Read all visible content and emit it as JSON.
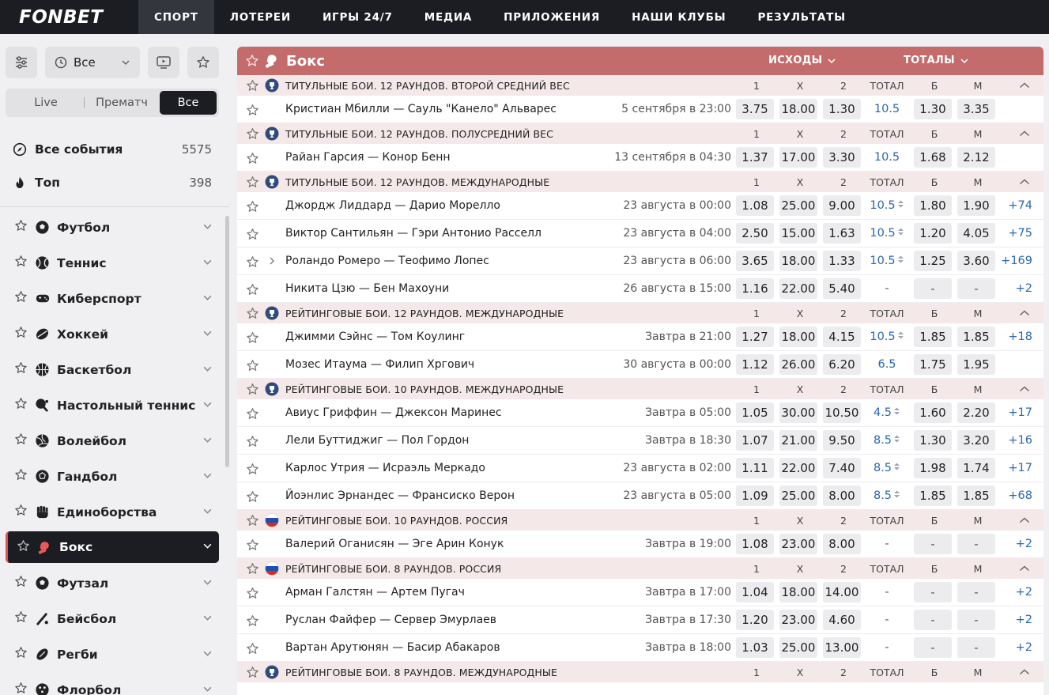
{
  "brand": "FONBET",
  "nav": [
    "СПОРТ",
    "ЛОТЕРЕИ",
    "ИГРЫ 24/7",
    "МЕДИА",
    "ПРИЛОЖЕНИЯ",
    "НАШИ КЛУБЫ",
    "РЕЗУЛЬТАТЫ"
  ],
  "sidebar": {
    "time_filter": "Все",
    "segments": [
      "Live",
      "Прематч",
      "Все"
    ],
    "summary": [
      {
        "label": "Все события",
        "count": "5575",
        "icon": "compass-icon"
      },
      {
        "label": "Топ",
        "count": "398",
        "icon": "flame-icon"
      }
    ],
    "sports": [
      {
        "label": "Футбол",
        "icon": "football-icon"
      },
      {
        "label": "Теннис",
        "icon": "tennis-icon"
      },
      {
        "label": "Киберспорт",
        "icon": "gamepad-icon"
      },
      {
        "label": "Хоккей",
        "icon": "hockey-icon"
      },
      {
        "label": "Баскетбол",
        "icon": "basketball-icon"
      },
      {
        "label": "Настольный теннис",
        "icon": "table-tennis-icon"
      },
      {
        "label": "Волейбол",
        "icon": "volleyball-icon"
      },
      {
        "label": "Гандбол",
        "icon": "handball-icon"
      },
      {
        "label": "Единоборства",
        "icon": "fist-icon"
      },
      {
        "label": "Бокс",
        "icon": "boxing-glove-icon",
        "active": true
      },
      {
        "label": "Футзал",
        "icon": "futsal-icon"
      },
      {
        "label": "Бейсбол",
        "icon": "baseball-icon"
      },
      {
        "label": "Регби",
        "icon": "rugby-icon"
      },
      {
        "label": "Флорбол",
        "icon": "floorball-icon"
      }
    ]
  },
  "main": {
    "title": "Бокс",
    "tab_outcomes": "ИСХОДЫ",
    "tab_totals": "ТОТАЛЫ",
    "columns": [
      "1",
      "X",
      "2",
      "ТОТАЛ",
      "Б",
      "М"
    ],
    "groups": [
      {
        "title": "ТИТУЛЬНЫЕ БОИ. 12 РАУНДОВ. ВТОРОЙ СРЕДНИЙ ВЕС",
        "flag": "cup",
        "events": [
          {
            "name": "Кристиан Мбилли — Сауль \"Канело\" Альварес",
            "time": "5 сентября в 23:00",
            "o1": "3.75",
            "ox": "18.00",
            "o2": "1.30",
            "total": "10.5",
            "b": "1.30",
            "m": "3.35",
            "more": "",
            "arrows": false,
            "expand": false
          }
        ]
      },
      {
        "title": "ТИТУЛЬНЫЕ БОИ. 12 РАУНДОВ. ПОЛУСРЕДНИЙ ВЕС",
        "flag": "cup",
        "events": [
          {
            "name": "Райан Гарсия — Конор Бенн",
            "time": "13 сентября в 04:30",
            "o1": "1.37",
            "ox": "17.00",
            "o2": "3.30",
            "total": "10.5",
            "b": "1.68",
            "m": "2.12",
            "more": "",
            "arrows": false,
            "expand": false
          }
        ]
      },
      {
        "title": "ТИТУЛЬНЫЕ БОИ. 12 РАУНДОВ. МЕЖДУНАРОДНЫЕ",
        "flag": "cup",
        "events": [
          {
            "name": "Джордж Лиддард — Дарио Морелло",
            "time": "23 августа в 00:00",
            "o1": "1.08",
            "ox": "25.00",
            "o2": "9.00",
            "total": "10.5",
            "b": "1.80",
            "m": "1.90",
            "more": "+74",
            "arrows": true,
            "expand": false
          },
          {
            "name": "Виктор Сантильян — Гэри Антонио Расселл",
            "time": "23 августа в 04:00",
            "o1": "2.50",
            "ox": "15.00",
            "o2": "1.63",
            "total": "10.5",
            "b": "1.20",
            "m": "4.05",
            "more": "+75",
            "arrows": true,
            "expand": false
          },
          {
            "name": "Роландо Ромеро — Теофимо Лопес",
            "time": "23 августа в 06:00",
            "o1": "3.65",
            "ox": "18.00",
            "o2": "1.33",
            "total": "10.5",
            "b": "1.25",
            "m": "3.60",
            "more": "+169",
            "arrows": true,
            "expand": true
          },
          {
            "name": "Никита Цзю — Бен Махоуни",
            "time": "26 августа в 15:00",
            "o1": "1.16",
            "ox": "22.00",
            "o2": "5.40",
            "total": "-",
            "b": "-",
            "m": "-",
            "more": "+2",
            "arrows": false,
            "expand": false
          }
        ]
      },
      {
        "title": "РЕЙТИНГОВЫЕ БОИ. 12 РАУНДОВ. МЕЖДУНАРОДНЫЕ",
        "flag": "cup",
        "events": [
          {
            "name": "Джимми Сэйнс — Том Коулинг",
            "time": "Завтра в 21:00",
            "o1": "1.27",
            "ox": "18.00",
            "o2": "4.15",
            "total": "10.5",
            "b": "1.85",
            "m": "1.85",
            "more": "+18",
            "arrows": true,
            "expand": false
          },
          {
            "name": "Мозес Итаума — Филип Хргович",
            "time": "30 августа в 00:00",
            "o1": "1.12",
            "ox": "26.00",
            "o2": "6.20",
            "total": "6.5",
            "b": "1.75",
            "m": "1.95",
            "more": "",
            "arrows": false,
            "expand": false
          }
        ]
      },
      {
        "title": "РЕЙТИНГОВЫЕ БОИ. 10 РАУНДОВ. МЕЖДУНАРОДНЫЕ",
        "flag": "cup",
        "events": [
          {
            "name": "Авиус Гриффин — Джексон Маринес",
            "time": "Завтра в 05:00",
            "o1": "1.05",
            "ox": "30.00",
            "o2": "10.50",
            "total": "4.5",
            "b": "1.60",
            "m": "2.20",
            "more": "+17",
            "arrows": true,
            "expand": false
          },
          {
            "name": "Лели Буттиджиг — Пол Гордон",
            "time": "Завтра в 18:30",
            "o1": "1.07",
            "ox": "21.00",
            "o2": "9.50",
            "total": "8.5",
            "b": "1.30",
            "m": "3.20",
            "more": "+16",
            "arrows": true,
            "expand": false
          },
          {
            "name": "Карлос Утрия — Исраэль Меркадо",
            "time": "23 августа в 02:00",
            "o1": "1.11",
            "ox": "22.00",
            "o2": "7.40",
            "total": "8.5",
            "b": "1.98",
            "m": "1.74",
            "more": "+17",
            "arrows": true,
            "expand": false
          },
          {
            "name": "Йоэнлис Эрнандес — Франсиско Верон",
            "time": "23 августа в 05:00",
            "o1": "1.09",
            "ox": "25.00",
            "o2": "8.00",
            "total": "8.5",
            "b": "1.85",
            "m": "1.85",
            "more": "+68",
            "arrows": true,
            "expand": false
          }
        ]
      },
      {
        "title": "РЕЙТИНГОВЫЕ БОИ. 10 РАУНДОВ. РОССИЯ",
        "flag": "ru",
        "events": [
          {
            "name": "Валерий Оганисян — Эге Арин Конук",
            "time": "Завтра в 19:00",
            "o1": "1.08",
            "ox": "23.00",
            "o2": "8.00",
            "total": "-",
            "b": "-",
            "m": "-",
            "more": "+2",
            "arrows": false,
            "expand": false
          }
        ]
      },
      {
        "title": "РЕЙТИНГОВЫЕ БОИ. 8 РАУНДОВ. РОССИЯ",
        "flag": "ru",
        "events": [
          {
            "name": "Арман Галстян — Артем Пугач",
            "time": "Завтра в 17:00",
            "o1": "1.04",
            "ox": "18.00",
            "o2": "14.00",
            "total": "-",
            "b": "-",
            "m": "-",
            "more": "+2",
            "arrows": false,
            "expand": false
          },
          {
            "name": "Руслан Файфер — Сервер Эмурлаев",
            "time": "Завтра в 17:30",
            "o1": "1.20",
            "ox": "23.00",
            "o2": "4.60",
            "total": "-",
            "b": "-",
            "m": "-",
            "more": "+2",
            "arrows": false,
            "expand": false
          },
          {
            "name": "Вартан Арутюнян — Басир Абакаров",
            "time": "Завтра в 18:00",
            "o1": "1.03",
            "ox": "25.00",
            "o2": "13.00",
            "total": "-",
            "b": "-",
            "m": "-",
            "more": "+2",
            "arrows": false,
            "expand": false
          }
        ]
      },
      {
        "title": "РЕЙТИНГОВЫЕ БОИ. 8 РАУНДОВ. МЕЖДУНАРОДНЫЕ",
        "flag": "cup",
        "events": []
      }
    ]
  }
}
